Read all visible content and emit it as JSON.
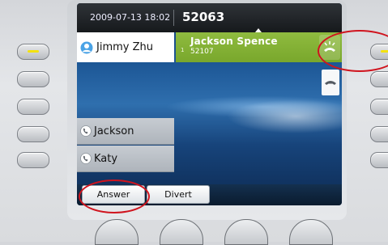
{
  "status_bar": {
    "datetime": "2009-07-13 18:02",
    "extension": "52063"
  },
  "lines": {
    "primary_line_name": "Jimmy Zhu",
    "active_call": {
      "line_number": "1",
      "name": "Jackson Spence",
      "number": "52107"
    }
  },
  "speed_dials": [
    {
      "label": "Jackson"
    },
    {
      "label": "Katy"
    }
  ],
  "softkeys": {
    "answer": "Answer",
    "divert": "Divert"
  },
  "icons": {
    "primary_line": "user-icon",
    "ringing": "ringing-phone-icon",
    "hang_up": "handset-icon",
    "speed_dial": "phone-dial-icon"
  },
  "colors": {
    "active_call_background": "#84B234",
    "line_led": "#F3E20F",
    "highlight_circle": "#D0141E",
    "screen_background": "#1D5796"
  }
}
